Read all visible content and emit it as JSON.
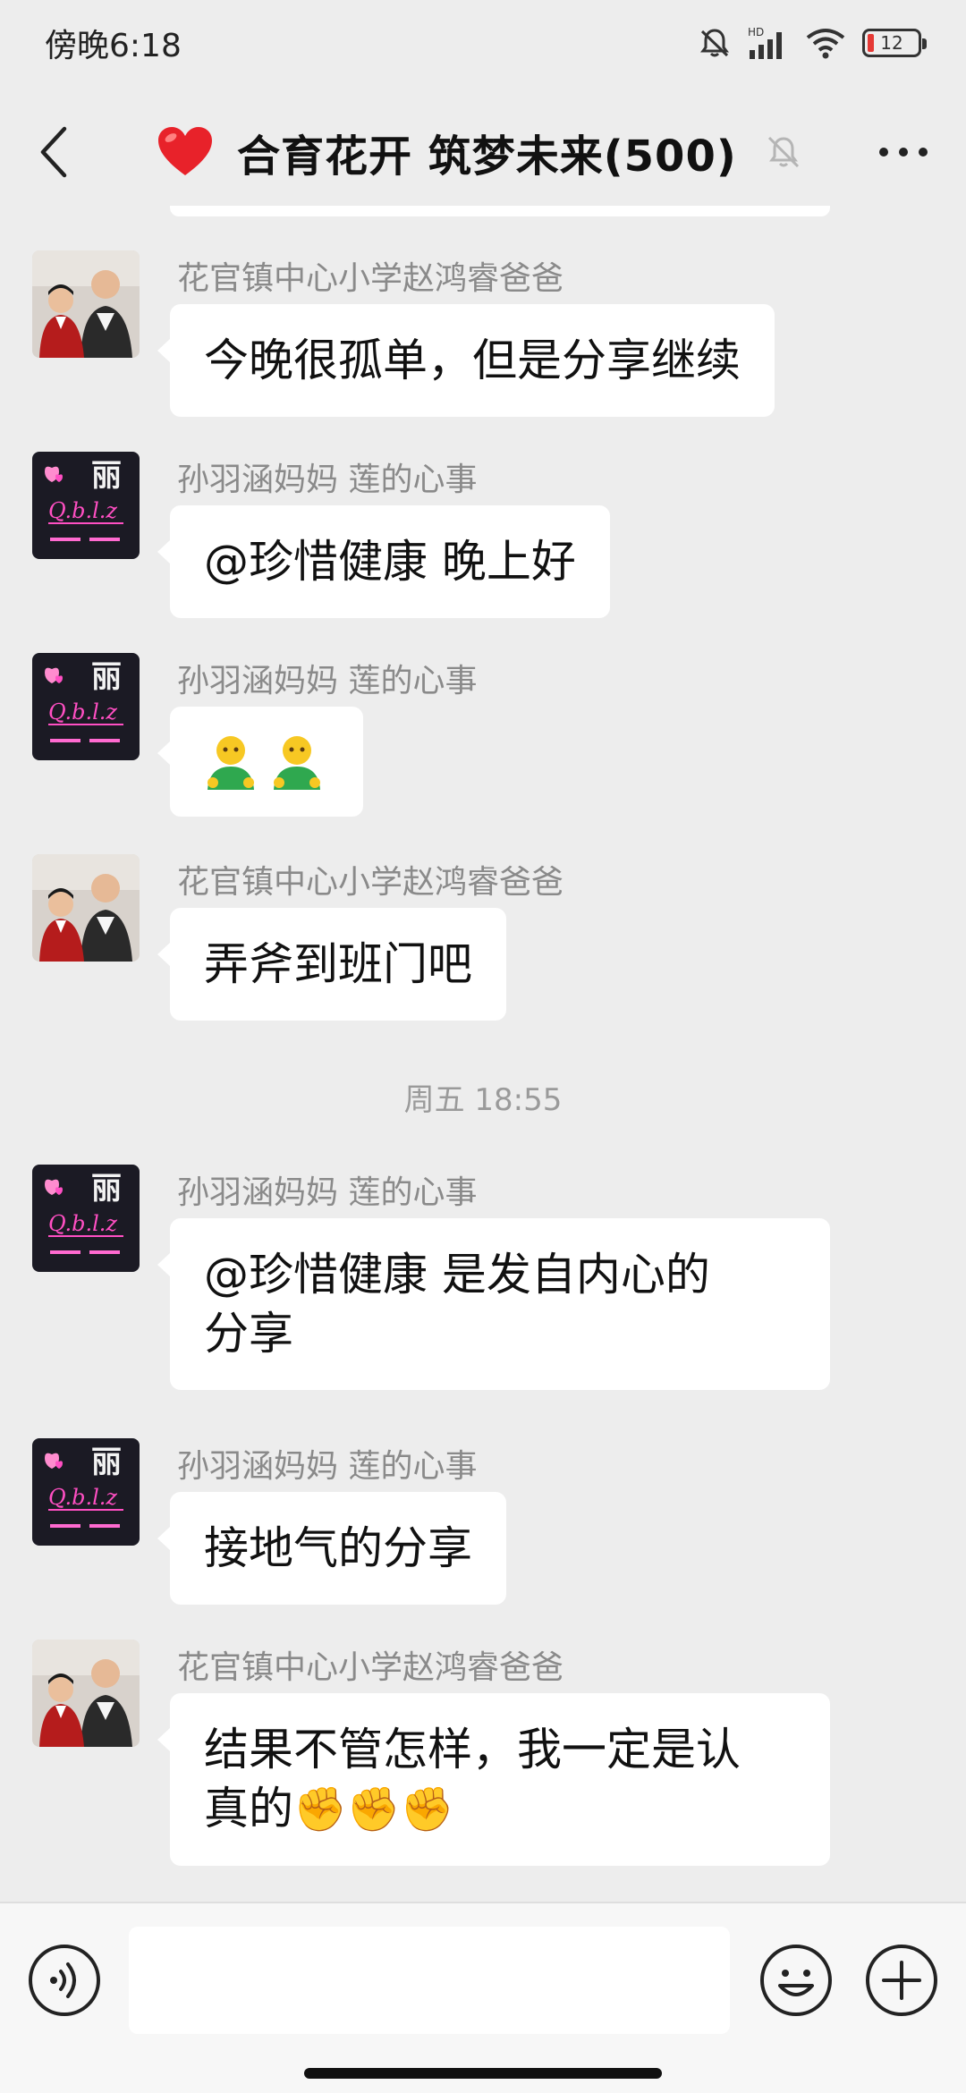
{
  "status_bar": {
    "time": "傍晚6:18",
    "battery": "12",
    "icons": [
      "mute-bell-icon",
      "hd-signal-icon",
      "wifi-icon",
      "battery-icon"
    ]
  },
  "header": {
    "title": "合育花开 筑梦未来(500)",
    "title_icon": "red-heart-icon",
    "muted": true
  },
  "messages": [
    {
      "sender": "花官镇中心小学赵鸿睿爸爸",
      "avatar": "father-son-photo",
      "text": "今晚很孤单，但是分享继续"
    },
    {
      "sender": "孙羽涵妈妈  莲的心事",
      "avatar": "neon-li-avatar",
      "text": "@珍惜健康  晚上好"
    },
    {
      "sender": "孙羽涵妈妈  莲的心事",
      "avatar": "neon-li-avatar",
      "emoji": [
        "person-emoji",
        "person-emoji"
      ]
    },
    {
      "sender": "花官镇中心小学赵鸿睿爸爸",
      "avatar": "father-son-photo",
      "text": "弄斧到班门吧"
    },
    {
      "sender": "孙羽涵妈妈  莲的心事",
      "avatar": "neon-li-avatar",
      "text_line1": "@珍惜健康  是发自内心的",
      "text_line2": "分享"
    },
    {
      "sender": "孙羽涵妈妈  莲的心事",
      "avatar": "neon-li-avatar",
      "text": "接地气的分享"
    },
    {
      "sender": "花官镇中心小学赵鸿睿爸爸",
      "avatar": "father-son-photo",
      "text_line1": "结果不管怎样，我一定是认",
      "text_line2": "真的",
      "trailing_emoji": "✊✊✊"
    }
  ],
  "time_separator": "周五 18:55",
  "avatar_neon": {
    "glyph": "丽",
    "script": "Q.b.l.z"
  },
  "colors": {
    "bubble": "#ffffff",
    "background": "#ededed",
    "neon": "#ff4fc3"
  }
}
